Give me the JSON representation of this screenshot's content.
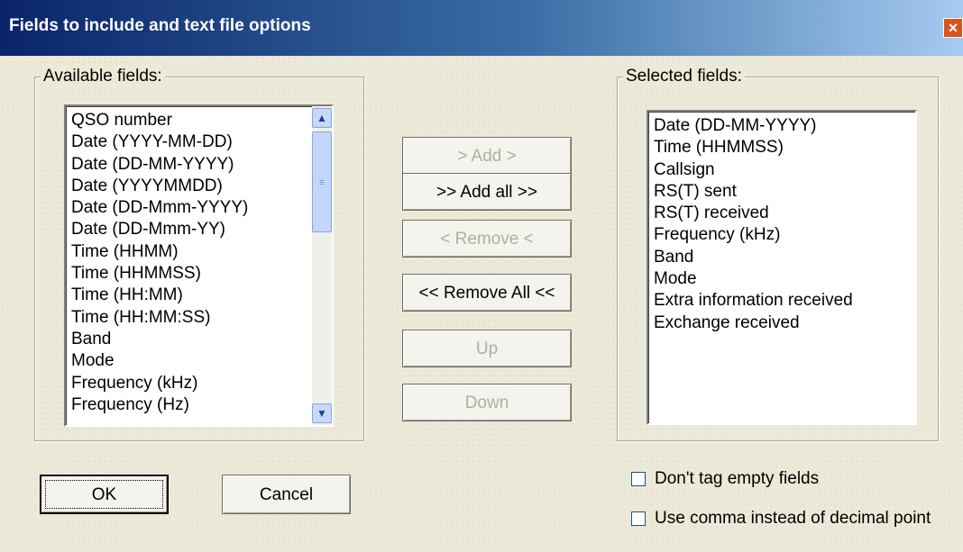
{
  "window": {
    "title": "Fields to include and text file options",
    "close_glyph": "×"
  },
  "available": {
    "label": "Available fields:",
    "items": [
      "QSO number",
      "Date (YYYY-MM-DD)",
      "Date (DD-MM-YYYY)",
      "Date (YYYYMMDD)",
      "Date (DD-Mmm-YYYY)",
      "Date (DD-Mmm-YY)",
      "Time (HHMM)",
      "Time (HHMMSS)",
      "Time (HH:MM)",
      "Time (HH:MM:SS)",
      "Band",
      "Mode",
      "Frequency (kHz)",
      "Frequency (Hz)"
    ],
    "scroll_up": "▲",
    "scroll_down": "▼",
    "thumb_grip": "≡"
  },
  "selected": {
    "label": "Selected fields:",
    "items": [
      "Date (DD-MM-YYYY)",
      "Time (HHMMSS)",
      "Callsign",
      "RS(T) sent",
      "RS(T) received",
      "Frequency (kHz)",
      "Band",
      "Mode",
      "Extra information received",
      "Exchange received"
    ]
  },
  "buttons": {
    "add": "> Add >",
    "add_all": ">> Add all >>",
    "remove": "< Remove <",
    "remove_all": "<< Remove All <<",
    "up": "Up",
    "down": "Down",
    "ok": "OK",
    "cancel": "Cancel"
  },
  "options": {
    "no_tag_empty": {
      "label": "Don't tag empty fields",
      "checked": false
    },
    "use_comma": {
      "label": "Use comma instead of decimal point",
      "checked": false
    }
  }
}
